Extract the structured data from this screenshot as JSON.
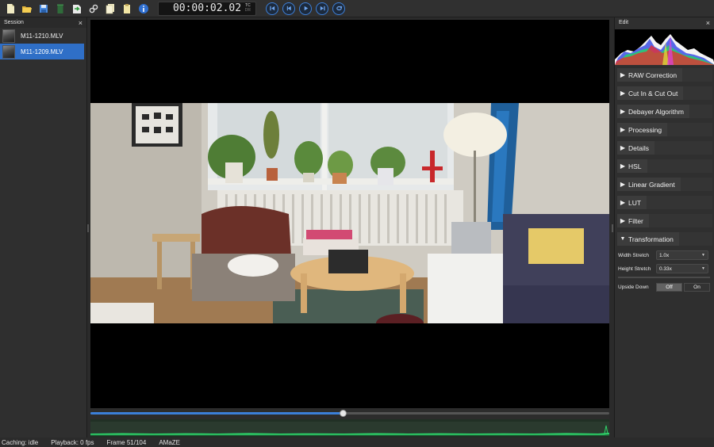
{
  "toolbar": {
    "icons": [
      "new-file-icon",
      "open-folder-icon",
      "save-icon",
      "trash-icon",
      "export-icon",
      "link-icon",
      "copy-icon",
      "paste-icon",
      "info-icon"
    ],
    "timecode": "00:00:02.02",
    "tc_label_top": "TC",
    "tc_label_bottom": "DR",
    "playback_buttons": [
      "jump-start-icon",
      "step-back-icon",
      "play-icon",
      "jump-end-icon",
      "loop-icon"
    ]
  },
  "session": {
    "title": "Session",
    "close": "×",
    "items": [
      {
        "label": "M11-1210.MLV",
        "selected": false
      },
      {
        "label": "M11-1209.MLV",
        "selected": true
      }
    ]
  },
  "timeline": {
    "progress": 0.486
  },
  "status": {
    "caching": "Caching: idle",
    "playback": "Playback: 0 fps",
    "frame": "Frame 51/104",
    "debayer": "AMaZE"
  },
  "edit": {
    "title": "Edit",
    "close": "×",
    "sections": [
      {
        "label": "RAW Correction",
        "expanded": false
      },
      {
        "label": "Cut In & Cut Out",
        "expanded": false
      },
      {
        "label": "Debayer Algorithm",
        "expanded": false
      },
      {
        "label": "Processing",
        "expanded": false
      },
      {
        "label": "Details",
        "expanded": false
      },
      {
        "label": "HSL",
        "expanded": false
      },
      {
        "label": "Linear Gradient",
        "expanded": false
      },
      {
        "label": "LUT",
        "expanded": false
      },
      {
        "label": "Filter",
        "expanded": false
      },
      {
        "label": "Transformation",
        "expanded": true
      }
    ],
    "width_stretch_label": "Width Stretch",
    "width_stretch_value": "1.0x",
    "height_stretch_label": "Height Stretch",
    "height_stretch_value": "0.33x",
    "upside_down_label": "Upside Down",
    "upside_off": "Off",
    "upside_on": "On"
  },
  "colors": {
    "accent": "#2f6fc7",
    "timeline_fill": "#3b7fd9",
    "audio_wave": "#2fd36a"
  }
}
